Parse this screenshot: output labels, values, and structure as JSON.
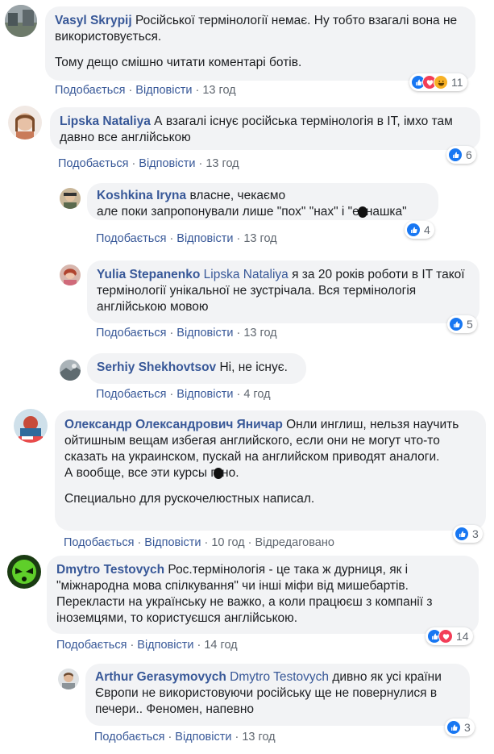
{
  "labels": {
    "like": "Подобається",
    "reply": "Відповісти",
    "edited": "Відредаговано"
  },
  "colors": {
    "link": "#385898",
    "bubble": "#f2f3f5",
    "meta": "#606770",
    "like": "#1877f2",
    "love": "#f33e58",
    "haha": "#f7b125"
  },
  "comments": [
    {
      "author": "Vasyl Skrypij",
      "paragraphs": [
        "Російської термінології немає. Ну тобто взагалі вона не використовується.",
        "Тому дещо смішно читати коментарі ботів."
      ],
      "time": "13 год",
      "reactions": {
        "icons": [
          "like-icon",
          "love-icon",
          "haha-icon"
        ],
        "count": "11"
      }
    },
    {
      "author": "Lipska Nataliya",
      "text": "А взагалі існує російська термінологія в ІТ, імхо там давно все англійською",
      "time": "13 год",
      "reactions": {
        "icons": [
          "like-icon"
        ],
        "count": "6"
      }
    },
    {
      "author": "Koshkina Iryna",
      "text_a": "власне, чекаємо",
      "text_b1": "але поки запропонували лише \"пох\" \"нах\" і \"е",
      "text_b2": "нашка\"",
      "time": "13 год",
      "reactions": {
        "icons": [
          "like-icon"
        ],
        "count": "4"
      }
    },
    {
      "author": "Yulia Stepanenko",
      "mention": "Lipska Nataliya",
      "text": "я за 20 років роботи в IT такої термінології унікальної не зустрічала. Вся термінологія англійською мовою",
      "time": "13 год",
      "reactions": {
        "icons": [
          "like-icon"
        ],
        "count": "5"
      }
    },
    {
      "author": "Serhiy Shekhovtsov",
      "text": "Ні, не існує.",
      "time": "4 год"
    },
    {
      "author": "Олександр Олександрович Яничар",
      "text": "Онли инглиш, нельзя научить ойтишным вещам избегая английского, если они не могут что-то сказать на украинском, пускай на английском приводят аналоги.",
      "text_b1": "А вообще, все эти курсы г",
      "text_b2": "но.",
      "text_c": "Специально для рускочелюстных написал.",
      "time": "10 год",
      "reactions": {
        "icons": [
          "like-icon"
        ],
        "count": "3"
      }
    },
    {
      "author": "Dmytro Testovych",
      "text": "Рос.термінологія - це така ж дурниця, як і \"міжнародна мова спілкування\" чи інші міфи від мишебартів. Перекласти на українську не важко, а коли працюєш з компанії з іноземцями, то користуєшся англійською.",
      "time": "14 год",
      "reactions": {
        "icons": [
          "like-icon",
          "love-icon"
        ],
        "count": "14"
      }
    },
    {
      "author": "Arthur Gerasymovych",
      "mention": "Dmytro Testovych",
      "text": "дивно як усі країни Європи не використовуючи російську ще не повернулися в печери.. Феномен, напевно",
      "time": "13 год",
      "reactions": {
        "icons": [
          "like-icon"
        ],
        "count": "3"
      }
    }
  ]
}
